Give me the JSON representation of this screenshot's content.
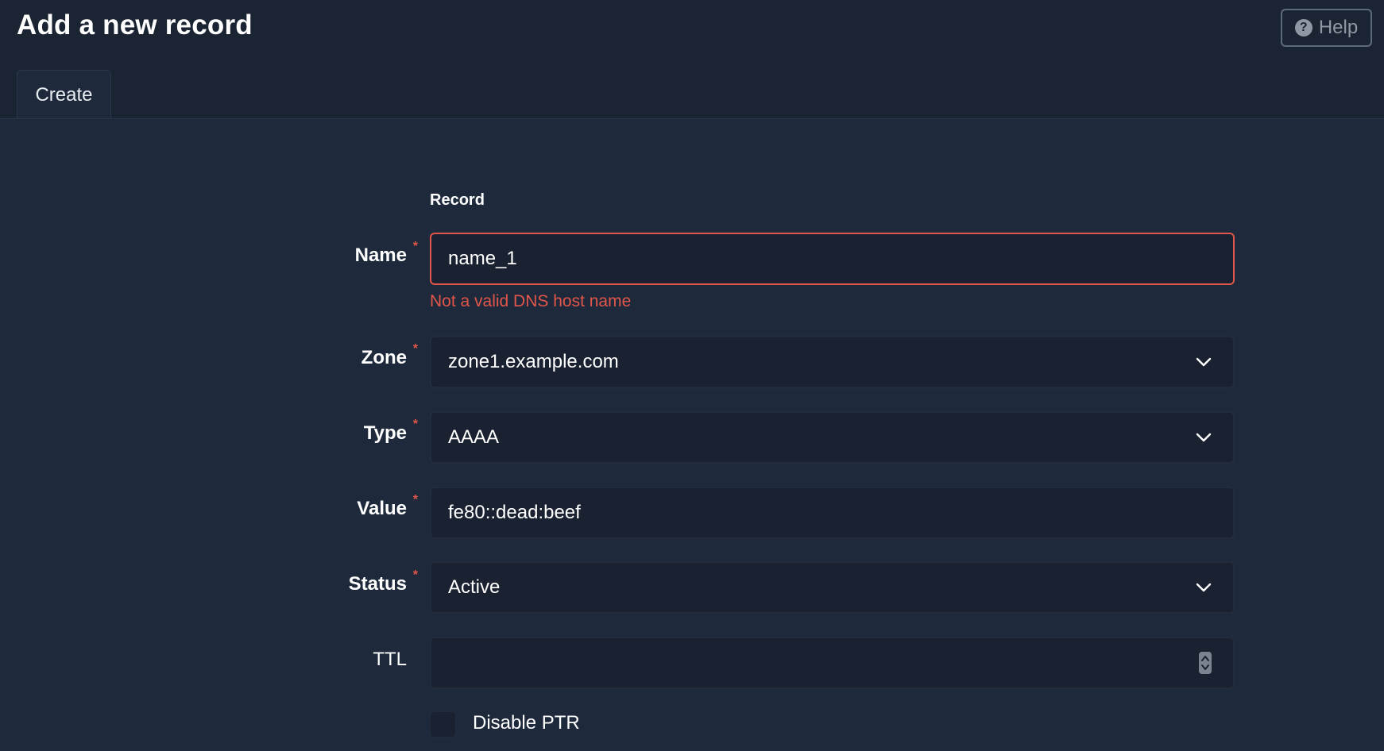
{
  "page": {
    "title": "Add a new record",
    "help_label": "Help"
  },
  "tabs": [
    {
      "label": "Create"
    }
  ],
  "form": {
    "section_title": "Record",
    "name": {
      "label": "Name",
      "required_mark": "*",
      "value": "name_1",
      "error": "Not a valid DNS host name"
    },
    "zone": {
      "label": "Zone",
      "required_mark": "*",
      "value": "zone1.example.com"
    },
    "type": {
      "label": "Type",
      "required_mark": "*",
      "value": "AAAA"
    },
    "value": {
      "label": "Value",
      "required_mark": "*",
      "value": "fe80::dead:beef"
    },
    "status": {
      "label": "Status",
      "required_mark": "*",
      "value": "Active"
    },
    "ttl": {
      "label": "TTL",
      "value": ""
    },
    "disable_ptr": {
      "label": "Disable PTR",
      "checked": false
    }
  },
  "icons": {
    "help": "question-circle-icon",
    "dropdown": "chevron-down-icon",
    "stepper": "number-stepper-icon"
  },
  "colors": {
    "error": "#e2554a",
    "background": "#1e2a3b",
    "header": "#1b2433",
    "input": "#1a2130"
  }
}
